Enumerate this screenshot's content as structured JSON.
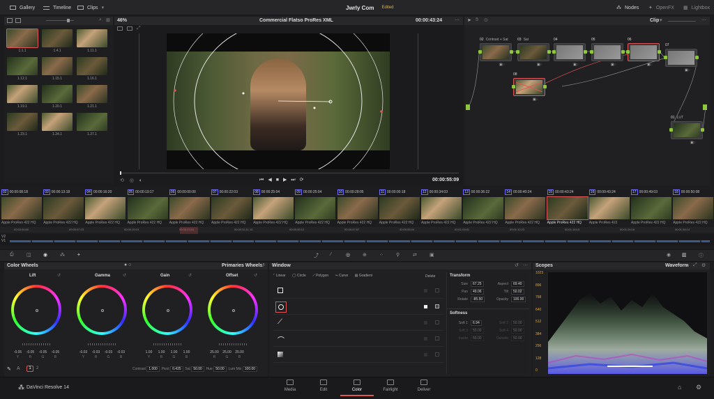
{
  "topbar": {
    "gallery": "Gallery",
    "timeline": "Timeline",
    "clips": "Clips",
    "project_title": "Jwrly Com",
    "project_status": "Edited",
    "nodes": "Nodes",
    "openfx": "OpenFX",
    "lightbox": "Lightbox"
  },
  "viewer": {
    "zoom": "46%",
    "title": "Commercial Flatso ProRes XML",
    "timecode": "00:00:43:24",
    "playhead_timecode": "00:00:55:09"
  },
  "node_editor": {
    "mode": "Clip",
    "nodes": [
      {
        "num": "02",
        "label": "Contrast + Sat"
      },
      {
        "num": "03",
        "label": "Sat"
      },
      {
        "num": "04",
        "label": ""
      },
      {
        "num": "05",
        "label": ""
      },
      {
        "num": "06",
        "label": ""
      },
      {
        "num": "07",
        "label": ""
      },
      {
        "num": "08",
        "label": ""
      },
      {
        "num": "01",
        "label": "LUT"
      }
    ]
  },
  "gallery": {
    "stills": [
      "1.1.1",
      "1.4.1",
      "1.11.1",
      "1.12.1",
      "1.15.1",
      "1.16.1",
      "1.19.1",
      "1.20.1",
      "1.21.1",
      "1.23.1",
      "1.24.1",
      "1.27.1"
    ]
  },
  "timeline": {
    "clips": [
      {
        "num": "02",
        "tc": "00:00:08:18",
        "codec": "Apple ProRes 422 HQ"
      },
      {
        "num": "03",
        "tc": "00:00:13:18",
        "codec": "Apple ProRes 422 HQ"
      },
      {
        "num": "04",
        "tc": "00:00:16:20",
        "codec": "Apple ProRes 422 HQ"
      },
      {
        "num": "05",
        "tc": "00:00:19:17",
        "codec": "Apple ProRes 422 HQ"
      },
      {
        "num": "06",
        "tc": "00:00:00:00",
        "codec": "Apple ProRes 422 HQ"
      },
      {
        "num": "07",
        "tc": "00:00:22:03",
        "codec": "Apple ProRes 422 HQ"
      },
      {
        "num": "08",
        "tc": "00:00:25:04",
        "codec": "Apple ProRes 422 HQ"
      },
      {
        "num": "09",
        "tc": "00:00:25:04",
        "codec": "Apple ProRes 422 HQ"
      },
      {
        "num": "10",
        "tc": "00:00:28:05",
        "codec": "Apple ProRes 422 HQ"
      },
      {
        "num": "11",
        "tc": "00:00:00:18",
        "codec": "Apple ProRes 422 HQ"
      },
      {
        "num": "12",
        "tc": "00:00:34:03",
        "codec": "Apple ProRes 422 HQ"
      },
      {
        "num": "13",
        "tc": "00:00:36:22",
        "codec": "Apple ProRes 422 HQ"
      },
      {
        "num": "14",
        "tc": "00:00:40:24",
        "codec": "Apple ProRes 422 HQ"
      },
      {
        "num": "15",
        "tc": "00:00:43:24",
        "codec": "Apple ProRes 422 HQ"
      },
      {
        "num": "16",
        "tc": "00:00:43:24",
        "codec": "Apple ProRes 422"
      },
      {
        "num": "17",
        "tc": "00:00:49:03",
        "codec": "Apple ProRes 422 HQ"
      },
      {
        "num": "18",
        "tc": "00:00:50:08",
        "codec": "Apple ProRes 422 HQ"
      }
    ],
    "ruler": [
      "00:00:00:00",
      "00:00:07:23",
      "00:00:15:19",
      "00:00:23:16",
      "00:00:31:11:13",
      "00:00:39:10",
      "00:00:47:07",
      "00:00:55:04",
      "00:01:03:01",
      "00:01:10:23",
      "00:01:18:19",
      "00:01:26:16",
      "00:01:34:14"
    ],
    "tracks": [
      "V2",
      "V1"
    ]
  },
  "color_wheels": {
    "title": "Color Wheels",
    "mode": "Primaries Wheels",
    "wheels": [
      {
        "name": "Lift",
        "values": [
          "-0.05",
          "-0.05",
          "-0.05",
          "-0.05"
        ],
        "labels": [
          "Y",
          "R",
          "G",
          "B"
        ]
      },
      {
        "name": "Gamma",
        "values": [
          "-0.03",
          "-0.03",
          "-0.03",
          "-0.03"
        ],
        "labels": [
          "Y",
          "R",
          "G",
          "B"
        ]
      },
      {
        "name": "Gain",
        "values": [
          "1.00",
          "1.00",
          "1.00",
          "1.00"
        ],
        "labels": [
          "Y",
          "R",
          "G",
          "B"
        ]
      },
      {
        "name": "Offset",
        "values": [
          "25.00",
          "25.00",
          "25.00"
        ],
        "labels": [
          "R",
          "G",
          "B"
        ]
      }
    ],
    "footer": {
      "page1": "1",
      "page2": "2",
      "contrast_label": "Contrast",
      "contrast": "1.000",
      "pivot_label": "Pivot",
      "pivot": "0.435",
      "sat_label": "Sat",
      "sat": "50.00",
      "hue_label": "Hue",
      "hue": "50.00",
      "lummix_label": "Lum Mix",
      "lummix": "100.00"
    }
  },
  "window": {
    "title": "Window",
    "tools": [
      "Linear",
      "Circle",
      "Polygon",
      "Curve",
      "Gradient"
    ],
    "delete": "Delete",
    "transform_title": "Transform",
    "transform": [
      {
        "label": "Size",
        "value": "67.25"
      },
      {
        "label": "Aspect",
        "value": "69.40"
      },
      {
        "label": "Pan",
        "value": "49.06"
      },
      {
        "label": "Tilt",
        "value": "50.02"
      },
      {
        "label": "Rotate",
        "value": "-85.50"
      },
      {
        "label": "Opacity",
        "value": "100.00"
      }
    ],
    "softness_title": "Softness",
    "softness": [
      {
        "label": "Soft 1",
        "value": "6.94"
      },
      {
        "label": "Soft 2",
        "value": "50.00"
      },
      {
        "label": "Soft 3",
        "value": "50.00"
      },
      {
        "label": "Soft 4",
        "value": "50.00"
      },
      {
        "label": "Inside",
        "value": "50.00"
      },
      {
        "label": "Outside",
        "value": "50.00"
      }
    ]
  },
  "scopes": {
    "title": "Scopes",
    "mode": "Waveform",
    "scale": [
      "1023",
      "896",
      "768",
      "640",
      "512",
      "384",
      "256",
      "128",
      "0"
    ]
  },
  "bottom_nav": {
    "app": "DaVinci Resolve 14",
    "items": [
      "Media",
      "Edit",
      "Color",
      "Fairlight",
      "Deliver"
    ],
    "active": "Color"
  }
}
